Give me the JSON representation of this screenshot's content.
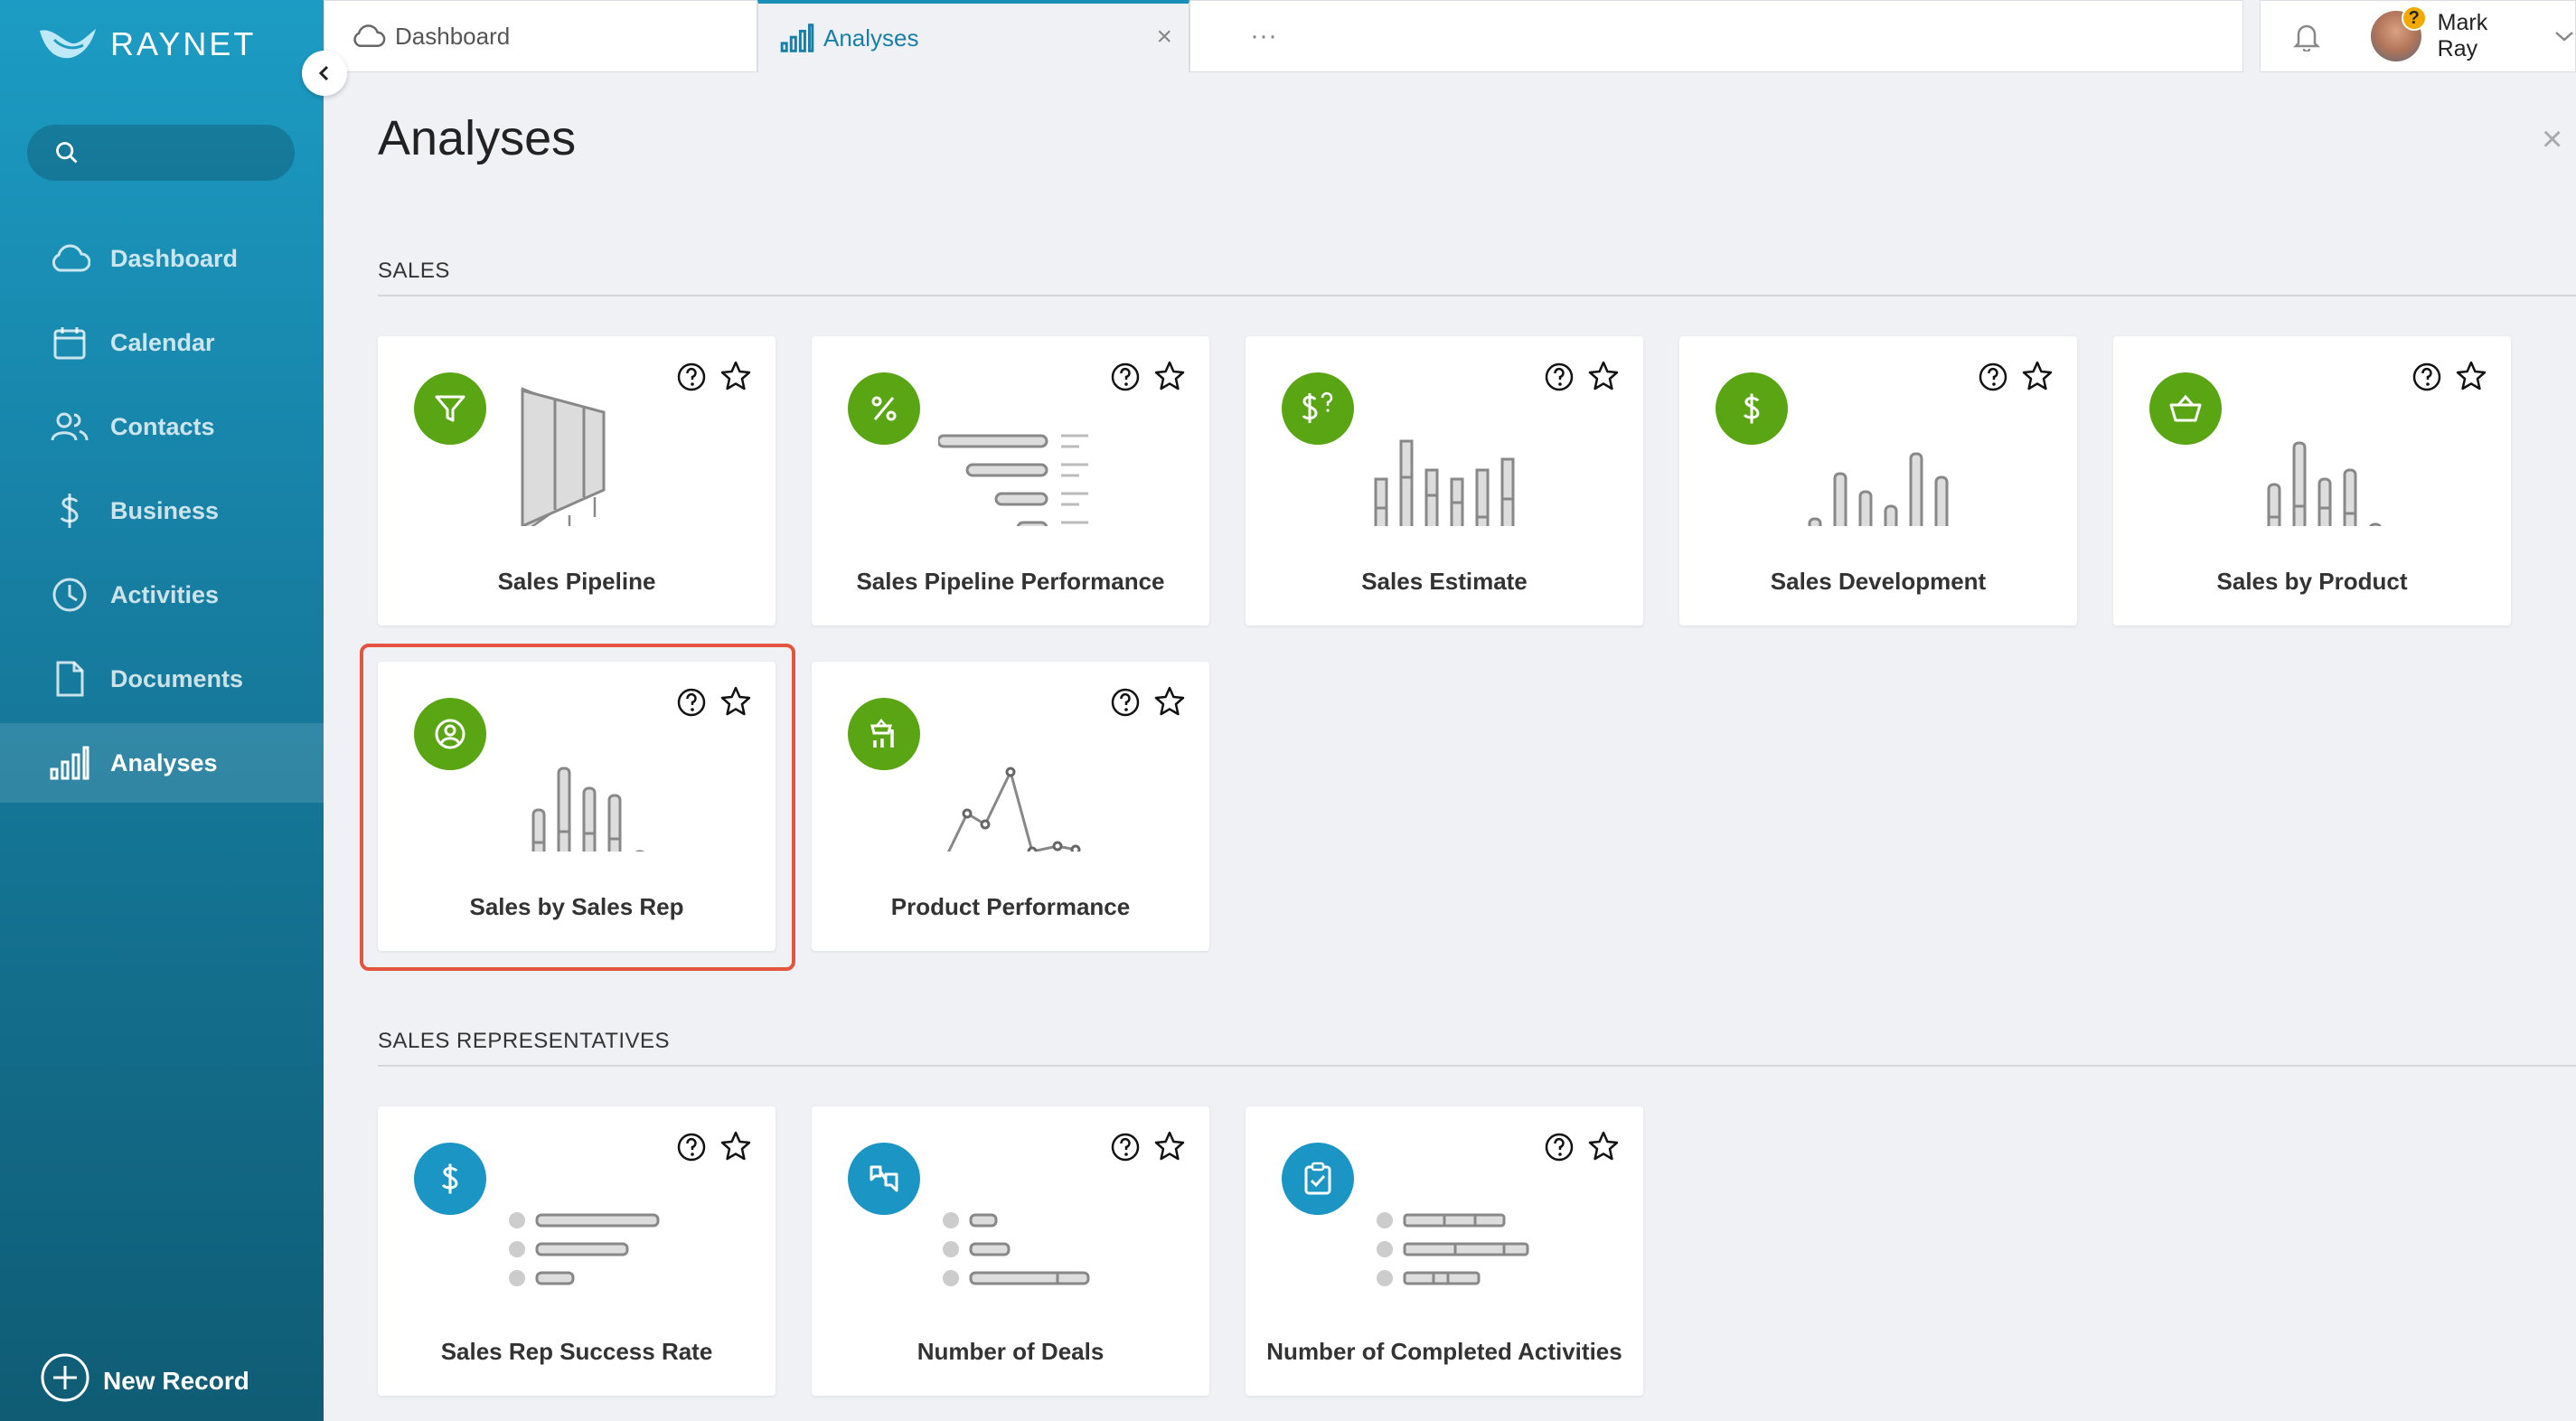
{
  "app": {
    "logo_text": "RAYNET"
  },
  "sidebar": {
    "search_placeholder": "",
    "items": [
      {
        "label": "Dashboard",
        "icon": "cloud-icon"
      },
      {
        "label": "Calendar",
        "icon": "calendar-icon"
      },
      {
        "label": "Contacts",
        "icon": "contacts-icon"
      },
      {
        "label": "Business",
        "icon": "dollar-icon"
      },
      {
        "label": "Activities",
        "icon": "clock-icon"
      },
      {
        "label": "Documents",
        "icon": "document-icon"
      },
      {
        "label": "Analyses",
        "icon": "bar-chart-icon",
        "active": true
      }
    ],
    "new_record_label": "New Record"
  },
  "tabs": [
    {
      "label": "Dashboard"
    },
    {
      "label": "Analyses",
      "active": true,
      "close": "×"
    },
    {
      "label": "···"
    }
  ],
  "user": {
    "name": "Mark Ray",
    "badge": "?"
  },
  "page": {
    "title": "Analyses",
    "close": "×"
  },
  "sections": [
    {
      "title": "SALES",
      "cards": [
        {
          "label": "Sales Pipeline",
          "icon": "funnel-icon"
        },
        {
          "label": "Sales Pipeline Performance",
          "icon": "percent-icon"
        },
        {
          "label": "Sales Estimate",
          "icon": "dollar-question-icon"
        },
        {
          "label": "Sales Development",
          "icon": "dollar-icon"
        },
        {
          "label": "Sales by Product",
          "icon": "basket-icon"
        },
        {
          "label": "Sales by Sales Rep",
          "icon": "user-circle-icon",
          "highlighted": true
        },
        {
          "label": "Product Performance",
          "icon": "product-chart-icon"
        }
      ]
    },
    {
      "title": "SALES REPRESENTATIVES",
      "cards": [
        {
          "label": "Sales Rep Success Rate",
          "icon": "dollar-icon"
        },
        {
          "label": "Number of Deals",
          "icon": "handshake-icon"
        },
        {
          "label": "Number of Completed Activities",
          "icon": "clipboard-check-icon"
        }
      ]
    }
  ],
  "colors": {
    "sidebar_top": "#1c9cc4",
    "sidebar_bottom": "#0f5c74",
    "green_badge": "#5aa514",
    "blue_badge": "#1b95c4",
    "highlight": "#e4553f",
    "accent": "#1a8fb7"
  }
}
